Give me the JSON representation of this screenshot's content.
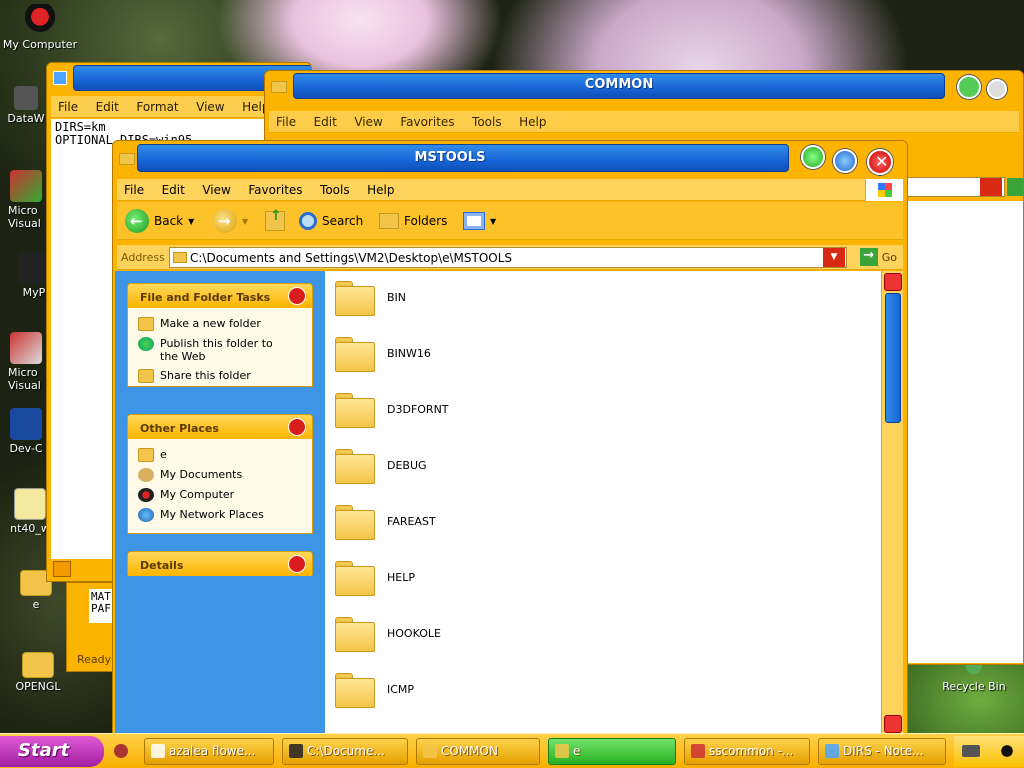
{
  "desktop": {
    "icons": [
      {
        "label": "My Computer"
      },
      {
        "label": "DataW"
      },
      {
        "label": "Micro Visual"
      },
      {
        "label": "MyP"
      },
      {
        "label": "Micro Visual"
      },
      {
        "label": "Dev-C"
      },
      {
        "label": "nt40_w"
      },
      {
        "label": "e"
      },
      {
        "label": "OPENGL"
      },
      {
        "label": "Recycle Bin"
      }
    ]
  },
  "notepad": {
    "menu": [
      "File",
      "Edit",
      "Format",
      "View",
      "Help"
    ],
    "lines": [
      "DIRS=km",
      "OPTIONAL_DIRS=win95"
    ],
    "status": "Ready",
    "fragment": [
      "MAT",
      "PAF"
    ]
  },
  "common": {
    "title": "COMMON",
    "menu": [
      "File",
      "Edit",
      "View",
      "Favorites",
      "Tools",
      "Help"
    ]
  },
  "explorer": {
    "title": "MSTOOLS",
    "menu": [
      "File",
      "Edit",
      "View",
      "Favorites",
      "Tools",
      "Help"
    ],
    "toolbar": {
      "back": "Back",
      "search": "Search",
      "folders": "Folders"
    },
    "address": {
      "label": "Address",
      "value": "C:\\Documents and Settings\\VM2\\Desktop\\e\\MSTOOLS",
      "go": "Go"
    },
    "tasks": {
      "title": "File and Folder Tasks",
      "items": [
        "Make a new folder",
        "Publish this folder to the Web",
        "Share this folder"
      ]
    },
    "places": {
      "title": "Other Places",
      "items": [
        "e",
        "My Documents",
        "My Computer",
        "My Network Places"
      ]
    },
    "details": {
      "title": "Details"
    },
    "folders": [
      "BIN",
      "BINW16",
      "D3DFORNT",
      "DEBUG",
      "FAREAST",
      "HELP",
      "HOOKOLE",
      "ICMP"
    ]
  },
  "taskbar": {
    "start": "Start",
    "tasks": [
      "azalea flowe...",
      "C:\\Docume...",
      "COMMON",
      "e",
      "sscommon -...",
      "DIRS - Note..."
    ]
  },
  "colors": {
    "accent": "#fcb400",
    "title_blue": "#1864d6",
    "panel_blue": "#3e95e6"
  }
}
